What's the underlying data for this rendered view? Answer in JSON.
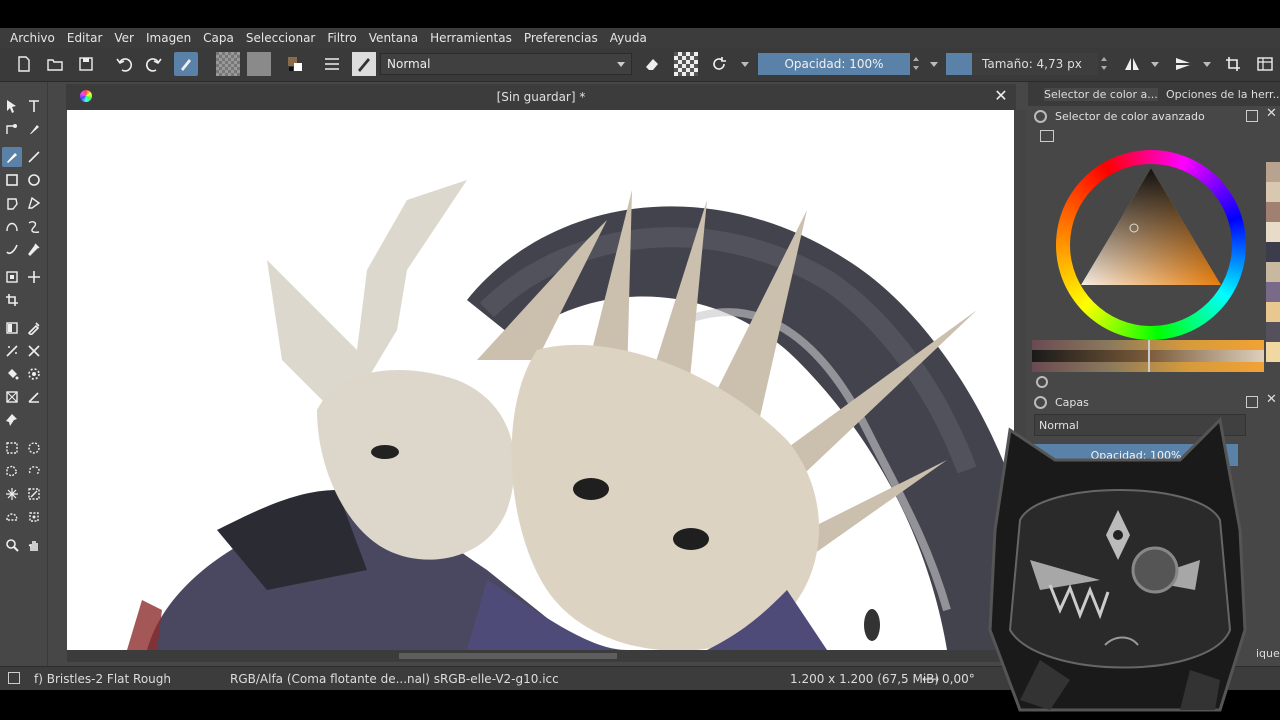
{
  "menu": [
    "Archivo",
    "Editar",
    "Ver",
    "Imagen",
    "Capa",
    "Seleccionar",
    "Filtro",
    "Ventana",
    "Herramientas",
    "Preferencias",
    "Ayuda"
  ],
  "toolbar": {
    "blend_mode": "Normal",
    "opacity": "Opacidad: 100%",
    "size": "Tamaño: 4,73 px"
  },
  "document": {
    "title": "[Sin guardar]  *"
  },
  "docker": {
    "tab1": "Selector de color a...",
    "tab2": "Opciones de la herr...",
    "color_panel_title": "Selector de color avanzado",
    "layers_title": "Capas",
    "layers_mode": "Normal",
    "layers_opacity": "Opacidad:  100%",
    "tag_label": "iquetа"
  },
  "status": {
    "brush": "f) Bristles-2 Flat Rough",
    "color_space": "RGB/Alfa (Coma flotante de...nal)  sRGB-elle-V2-g10.icc",
    "dimensions": "1.200 x 1.200 (67,5 MiB)",
    "rotation": "0,00°"
  },
  "colors": {
    "accent": "#5a82a8",
    "panel_bg": "#474747",
    "bar_bg": "#3c3c3c"
  }
}
